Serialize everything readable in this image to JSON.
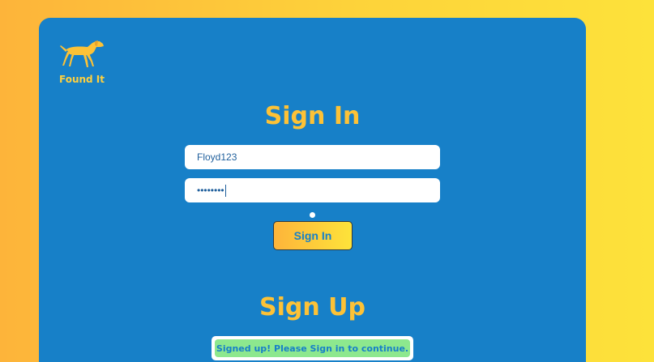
{
  "brand": {
    "name": "Found It",
    "logo_icon": "dog-icon"
  },
  "signin": {
    "title": "Sign In",
    "username_value": "Floyd123",
    "password_masked": "••••••••",
    "button_label": "Sign In"
  },
  "signup": {
    "title": "Sign Up",
    "message": "Signed up! Please Sign in to continue."
  },
  "colors": {
    "card": "#1780c8",
    "accent_yellow": "#fdc236",
    "success_green": "#8de88e"
  }
}
